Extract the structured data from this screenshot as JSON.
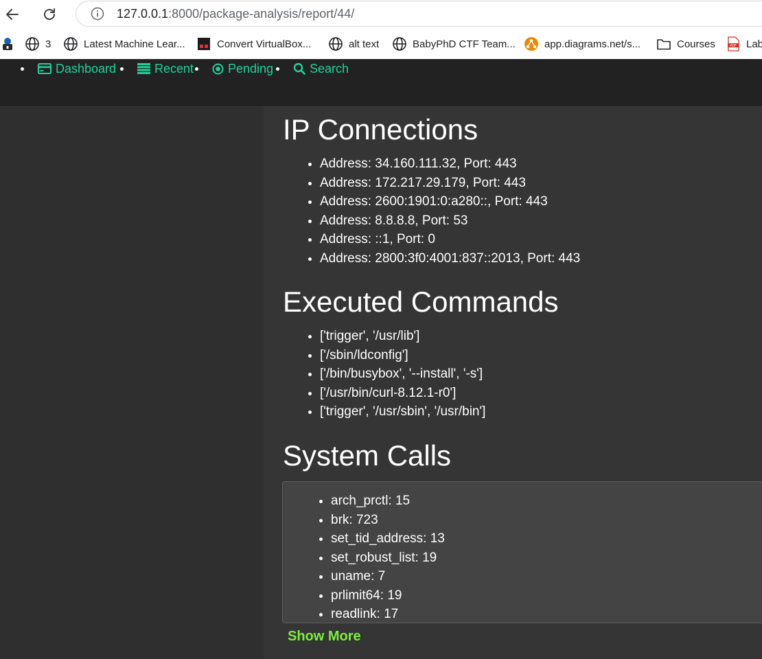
{
  "browser": {
    "url_host": "127.0.0.1",
    "url_rest": ":8000/package-analysis/report/44/",
    "bookmarks": [
      {
        "icon": "lock-profile-icon",
        "label": ""
      },
      {
        "icon": "globe-icon",
        "label": "3"
      },
      {
        "icon": "globe-icon",
        "label": "Latest Machine Lear..."
      },
      {
        "icon": "virtualbox-icon",
        "label": "Convert VirtualBox..."
      },
      {
        "icon": "globe-icon",
        "label": "alt text"
      },
      {
        "icon": "globe-icon",
        "label": "BabyPhD CTF Team..."
      },
      {
        "icon": "diagrams-icon",
        "label": "app.diagrams.net/s..."
      },
      {
        "icon": "folder-icon",
        "label": "Courses"
      },
      {
        "icon": "pdf-icon",
        "label": "Lab"
      }
    ]
  },
  "nav": {
    "items": [
      {
        "icon": "dashboard-card-icon",
        "label": "Dashboard"
      },
      {
        "icon": "list-icon",
        "label": "Recent"
      },
      {
        "icon": "pending-circle-icon",
        "label": "Pending"
      },
      {
        "icon": "search-icon",
        "label": "Search"
      }
    ]
  },
  "ip_connections": {
    "title": "IP Connections",
    "items": [
      "Address: 34.160.111.32, Port: 443",
      "Address: 172.217.29.179, Port: 443",
      "Address: 2600:1901:0:a280::, Port: 443",
      "Address: 8.8.8.8, Port: 53",
      "Address: ::1, Port: 0",
      "Address: 2800:3f0:4001:837::2013, Port: 443"
    ]
  },
  "executed_commands": {
    "title": "Executed Commands",
    "items": [
      "['trigger', '/usr/lib']",
      "['/sbin/ldconfig']",
      "['/bin/busybox', '--install', '-s']",
      "['/usr/bin/curl-8.12.1-r0']",
      "['trigger', '/usr/sbin', '/usr/bin']"
    ]
  },
  "system_calls": {
    "title": "System Calls",
    "items": [
      "arch_prctl: 15",
      "brk: 723",
      "set_tid_address: 13",
      "set_robust_list: 19",
      "uname: 7",
      "prlimit64: 19",
      "readlink: 17"
    ],
    "show_more_label": "Show More"
  },
  "colors": {
    "nav_accent": "#1ed39a",
    "show_more": "#7cf03c",
    "page_bg": "#2f2f2f",
    "content_bg": "#353535",
    "navbar_bg": "#222222"
  }
}
